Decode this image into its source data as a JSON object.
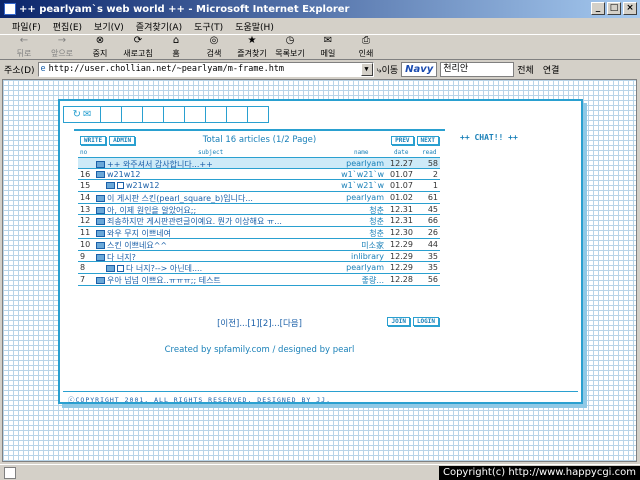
{
  "window": {
    "title": "++ pearlyam`s web world ++ - Microsoft Internet Explorer"
  },
  "menu": [
    "파일(F)",
    "편집(E)",
    "보기(V)",
    "즐겨찾기(A)",
    "도구(T)",
    "도움말(H)"
  ],
  "toolbar": [
    {
      "label": "뒤로",
      "icon": "back-arrow-icon",
      "enabled": false
    },
    {
      "label": "앞으로",
      "icon": "forward-arrow-icon",
      "enabled": false
    },
    {
      "label": "중지",
      "icon": "stop-icon",
      "enabled": true
    },
    {
      "label": "새로고침",
      "icon": "refresh-icon",
      "enabled": true
    },
    {
      "label": "홈",
      "icon": "home-icon",
      "enabled": true
    },
    {
      "label": "검색",
      "icon": "search-icon",
      "enabled": true
    },
    {
      "label": "즐겨찾기",
      "icon": "favorites-icon",
      "enabled": true
    },
    {
      "label": "목록보기",
      "icon": "history-icon",
      "enabled": true
    },
    {
      "label": "메일",
      "icon": "mail-icon",
      "enabled": true
    },
    {
      "label": "인쇄",
      "icon": "print-icon",
      "enabled": true
    }
  ],
  "address": {
    "label": "주소(D)",
    "url": "http://user.chollian.net/~pearlyam/m-frame.htm",
    "go_label": "이동",
    "navy": "Navy",
    "search_value": "천리안",
    "search_scope": "전체",
    "links_label": "연결"
  },
  "board": {
    "info": "Total 16 articles (1/2 Page)",
    "buttons_left": [
      "WRITE",
      "ADMIN"
    ],
    "buttons_right": [
      "PREV",
      "NEXT"
    ],
    "columns": [
      "no",
      "subject",
      "name",
      "date",
      "read"
    ],
    "rows": [
      {
        "no": "",
        "subject": "++ 와주셔서 감사합니다...++",
        "name": "pearlyam",
        "date": "12.27",
        "read": "58",
        "indent": 0,
        "highlight": true
      },
      {
        "no": "16",
        "subject": "w21w12",
        "name": "w1`w21`w",
        "date": "01.07",
        "read": "2",
        "indent": 0,
        "highlight": false
      },
      {
        "no": "15",
        "subject": "w21w12",
        "name": "w1`w21`w",
        "date": "01.07",
        "read": "1",
        "indent": 1,
        "highlight": false
      },
      {
        "no": "14",
        "subject": "이 게시판 스킨(pearl_square_b)입니다...",
        "name": "pearlyam",
        "date": "01.02",
        "read": "61",
        "indent": 0,
        "highlight": false
      },
      {
        "no": "13",
        "subject": "아, 이제 원인을 알았어요;;",
        "name": "청춘",
        "date": "12.31",
        "read": "45",
        "indent": 0,
        "highlight": false
      },
      {
        "no": "12",
        "subject": "죄송하지만 게시판관련글이예요. 뭔가 이상해요 ㅠ...",
        "name": "청춘",
        "date": "12.31",
        "read": "66",
        "indent": 0,
        "highlight": false
      },
      {
        "no": "11",
        "subject": "와우 무지 이쁘네여",
        "name": "청춘",
        "date": "12.30",
        "read": "26",
        "indent": 0,
        "highlight": false
      },
      {
        "no": "10",
        "subject": "스킨 이쁘네요^^",
        "name": "미소家",
        "date": "12.29",
        "read": "44",
        "indent": 0,
        "highlight": false
      },
      {
        "no": "9",
        "subject": "다 너지?",
        "name": "inlibrary",
        "date": "12.29",
        "read": "35",
        "indent": 0,
        "highlight": false
      },
      {
        "no": "8",
        "subject": "다 너지?--> 아닌데....",
        "name": "pearlyam",
        "date": "12.29",
        "read": "35",
        "indent": 1,
        "highlight": false
      },
      {
        "no": "7",
        "subject": "우아 넘넘 이쁘요..ㅠㅠㅠ;; 테스트",
        "name": "좋량...",
        "date": "12.28",
        "read": "56",
        "indent": 0,
        "highlight": false
      }
    ],
    "pager": "[이전]...[1][2]...[다음]",
    "buttons_bottom": [
      "JOIN",
      "LOGIN"
    ],
    "credit": "Created by spfamily.com / designed by pearl"
  },
  "chat": "++ CHAT!! ++",
  "copyright_bottom": "ⓒCOPYRIGHT 2001. ALL RIGHTS RESERVED. DESIGNED BY JJ.",
  "overlay_copyright": "Copyright(c) http://www.happycgi.com"
}
